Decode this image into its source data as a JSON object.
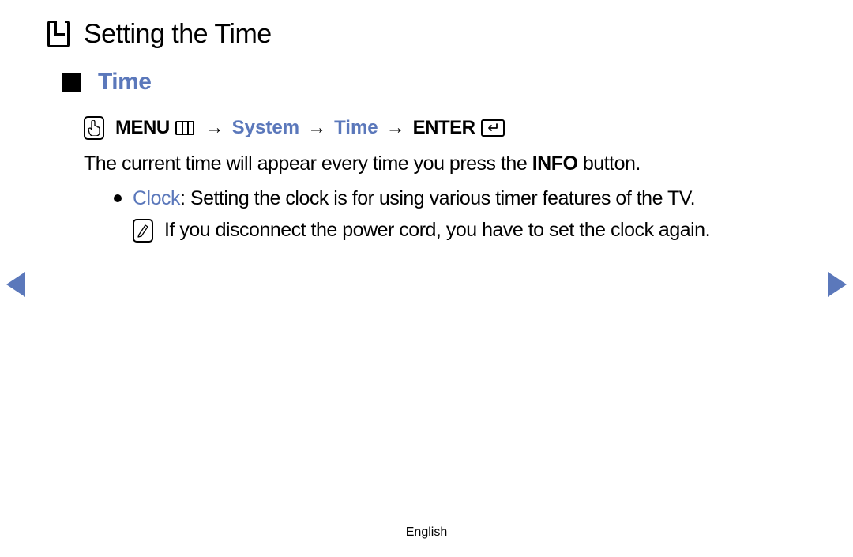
{
  "page_title": "Setting the Time",
  "section_title": "Time",
  "nav_path": {
    "menu_label": "MENU",
    "arrow": "→",
    "step1": "System",
    "step2": "Time",
    "enter_label": "ENTER"
  },
  "body": {
    "intro_pre": "The current time will appear every time you press the ",
    "intro_bold": "INFO",
    "intro_post": " button."
  },
  "bullet": {
    "label": "Clock",
    "text": ": Setting the clock is for using various timer features of the TV."
  },
  "note": {
    "text": "If you disconnect the power cord, you have to set the clock again."
  },
  "footer": "English"
}
